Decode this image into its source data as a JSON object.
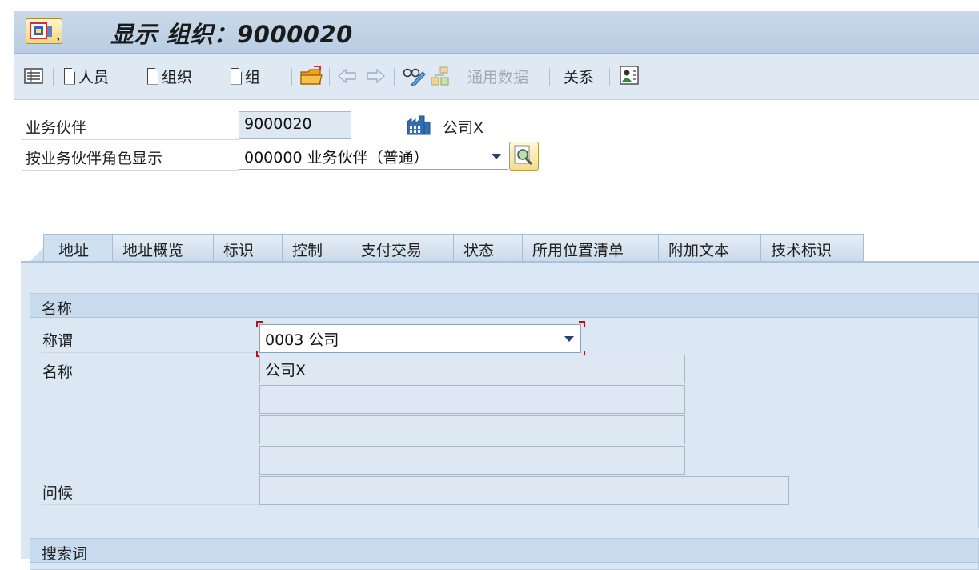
{
  "title_bar": {
    "title": "显示 组织：9000020"
  },
  "toolbar": {
    "person_label": "人员",
    "org_label": "组织",
    "group_label": "组",
    "general_data_label": "通用数据",
    "relations_label": "关系"
  },
  "header_fields": {
    "bp_label": "业务伙伴",
    "bp_value": "9000020",
    "bp_name": "公司X",
    "role_label": "按业务伙伴角色显示",
    "role_value": "000000 业务伙伴（普通）"
  },
  "tabs": [
    {
      "label": "地址",
      "active": true
    },
    {
      "label": "地址概览"
    },
    {
      "label": "标识"
    },
    {
      "label": "控制"
    },
    {
      "label": "支付交易"
    },
    {
      "label": "状态"
    },
    {
      "label": "所用位置清单"
    },
    {
      "label": "附加文本"
    },
    {
      "label": "技术标识"
    }
  ],
  "name_group": {
    "title": "名称",
    "salutation_label": "称谓",
    "salutation_value": "0003 公司",
    "name_label": "名称",
    "name_line1": "公司X",
    "name_line2": "",
    "name_line3": "",
    "name_line4": "",
    "greeting_label": "问候",
    "greeting_value": ""
  },
  "search_group": {
    "title": "搜索词"
  },
  "colors": {
    "title_bar": "#c9d9e9",
    "toolbar": "#dfe9f4",
    "panel": "#dbe8f4",
    "focus": "#b8111f"
  }
}
